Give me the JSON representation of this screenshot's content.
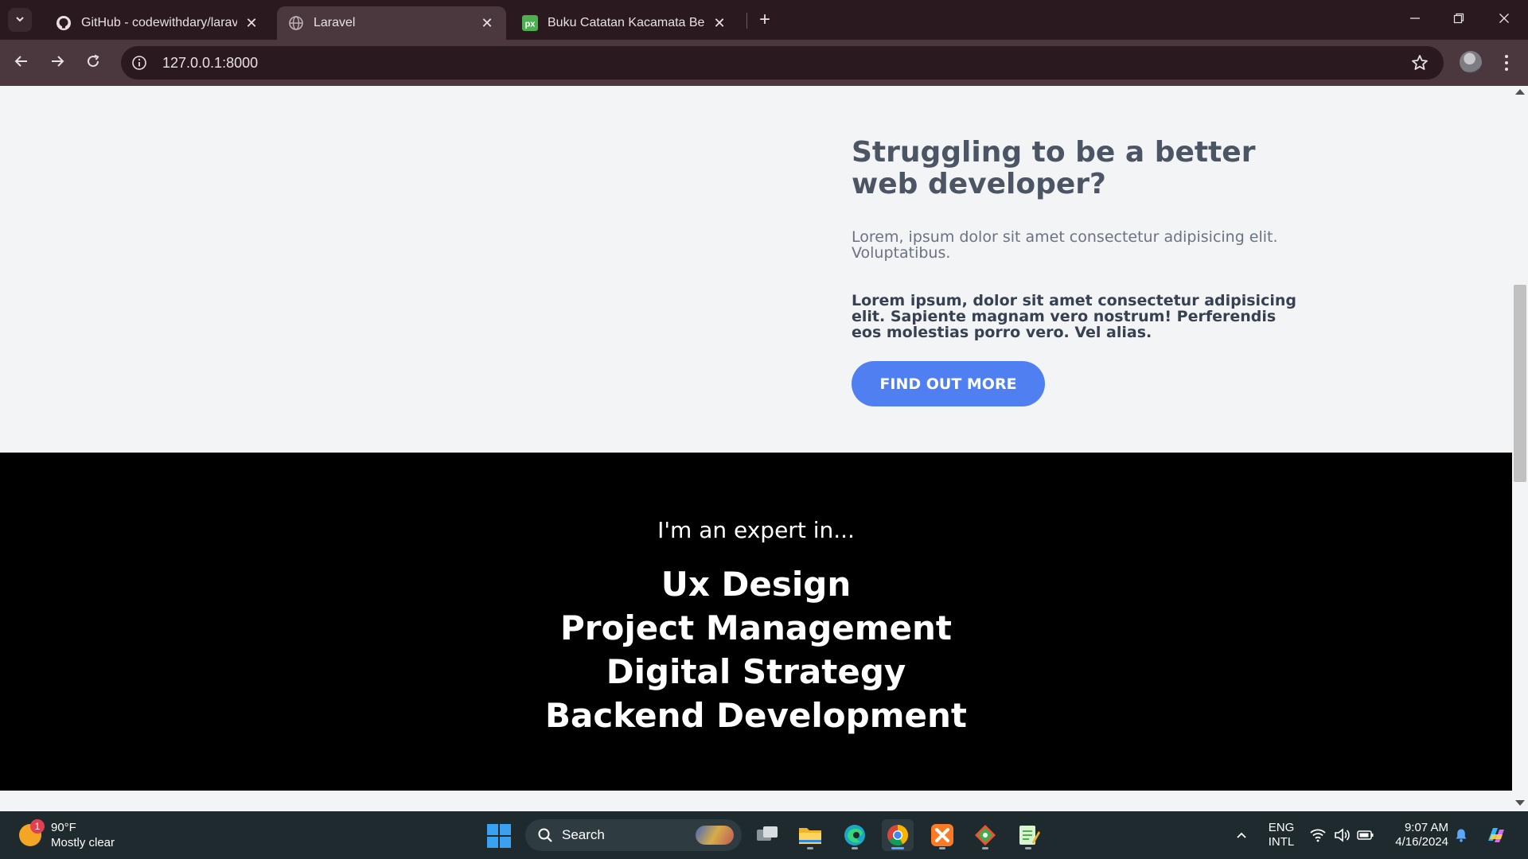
{
  "browser": {
    "tabs": [
      {
        "title": "GitHub - codewithdary/laravel-l",
        "favicon": "github-icon",
        "active": false
      },
      {
        "title": "Laravel",
        "favicon": "globe-icon",
        "active": true
      },
      {
        "title": "Buku Catatan Kacamata Beperg",
        "favicon": "pixiv-icon",
        "active": false
      }
    ],
    "url": "127.0.0.1:8000"
  },
  "page": {
    "hero": {
      "heading": "Struggling to be a better web developer?",
      "lead": "Lorem, ipsum dolor sit amet consectetur adipisicing elit. Voluptatibus.",
      "strong_text": "Lorem ipsum, dolor sit amet consectetur adipisicing elit. Sapiente magnam vero nostrum! Perferendis eos molestias porro vero. Vel alias.",
      "cta_label": "Find out more",
      "cta_color": "#4f7ff0"
    },
    "expertise": {
      "intro": "I'm an expert in...",
      "skills": [
        "Ux Design",
        "Project Management",
        "Digital Strategy",
        "Backend Development"
      ]
    }
  },
  "taskbar": {
    "weather": {
      "temp": "90°F",
      "condition": "Mostly clear",
      "badge": "1"
    },
    "search_label": "Search",
    "language": {
      "line1": "ENG",
      "line2": "INTL"
    },
    "clock": {
      "time": "9:07 AM",
      "date": "4/16/2024"
    }
  }
}
